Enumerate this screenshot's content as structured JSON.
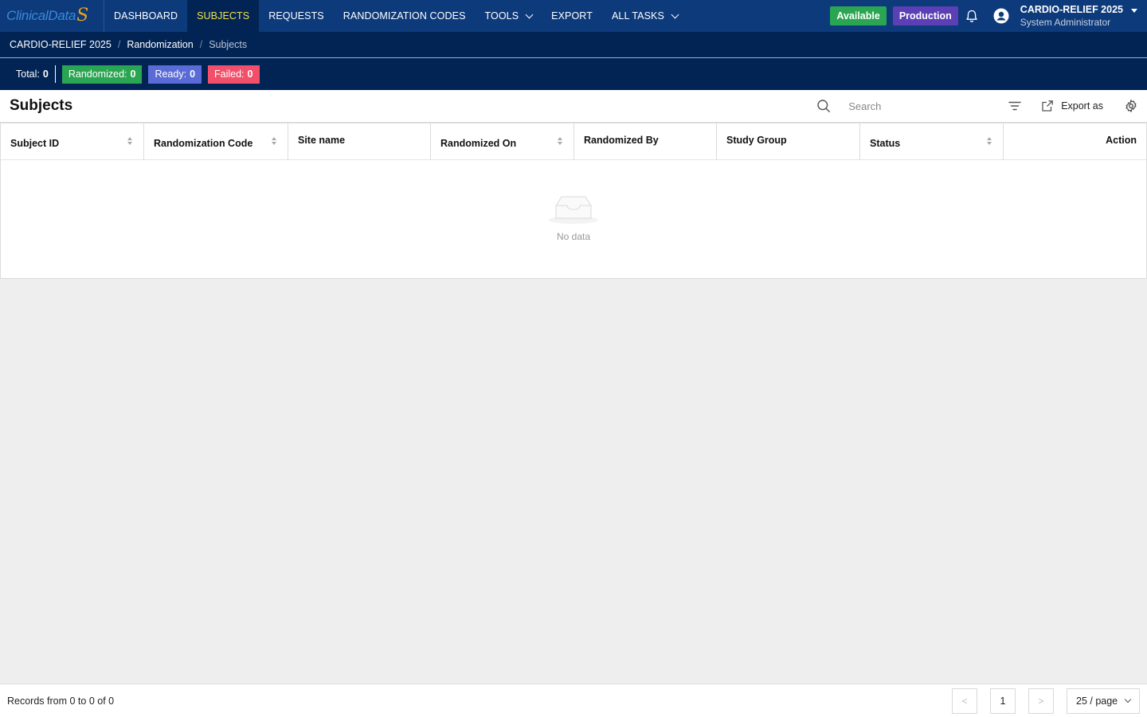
{
  "app": {
    "logo_text": "ClinicalData",
    "logo_mark": "S"
  },
  "nav": {
    "items": [
      {
        "label": "DASHBOARD",
        "active": false
      },
      {
        "label": "SUBJECTS",
        "active": true
      },
      {
        "label": "REQUESTS",
        "active": false
      },
      {
        "label": "RANDOMIZATION CODES",
        "active": false
      },
      {
        "label": "TOOLS",
        "active": false,
        "dropdown": true
      },
      {
        "label": "EXPORT",
        "active": false
      },
      {
        "label": "ALL TASKS",
        "active": false,
        "dropdown": true
      }
    ]
  },
  "header": {
    "available_label": "Available",
    "env_label": "Production",
    "study_name": "CARDIO-RELIEF 2025",
    "user_role": "System Administrator",
    "icons": [
      "bell-icon",
      "user-avatar-icon",
      "caret-down-icon"
    ]
  },
  "breadcrumb": {
    "items": [
      "CARDIO-RELIEF 2025",
      "Randomization",
      "Subjects"
    ],
    "separator": "/"
  },
  "stats": {
    "total_label": "Total:",
    "total_value": "0",
    "randomized_label": "Randomized:",
    "randomized_value": "0",
    "ready_label": "Ready:",
    "ready_value": "0",
    "failed_label": "Failed:",
    "failed_value": "0"
  },
  "toolbar": {
    "title": "Subjects",
    "search_placeholder": "Search",
    "export_label": "Export as"
  },
  "table": {
    "columns": [
      {
        "label": "Subject ID",
        "sortable": true
      },
      {
        "label": "Randomization Code",
        "sortable": true
      },
      {
        "label": "Site name",
        "sortable": false
      },
      {
        "label": "Randomized On",
        "sortable": true
      },
      {
        "label": "Randomized By",
        "sortable": false
      },
      {
        "label": "Study Group",
        "sortable": false
      },
      {
        "label": "Status",
        "sortable": true
      },
      {
        "label": "Action",
        "sortable": false
      }
    ],
    "rows": [],
    "empty_text": "No data"
  },
  "footer": {
    "records_text": "Records from 0 to 0 of 0",
    "current_page": "1",
    "page_size_label": "25 / page",
    "prev_symbol": "<",
    "next_symbol": ">"
  },
  "colors": {
    "nav_bg": "#0d3a7a",
    "nav_active_bg": "#022454",
    "nav_active_text": "#f3e04a",
    "available": "#2aa552",
    "production": "#5b3fb5",
    "randomized": "#2aa552",
    "ready": "#5a6bd8",
    "failed": "#f2506a"
  }
}
